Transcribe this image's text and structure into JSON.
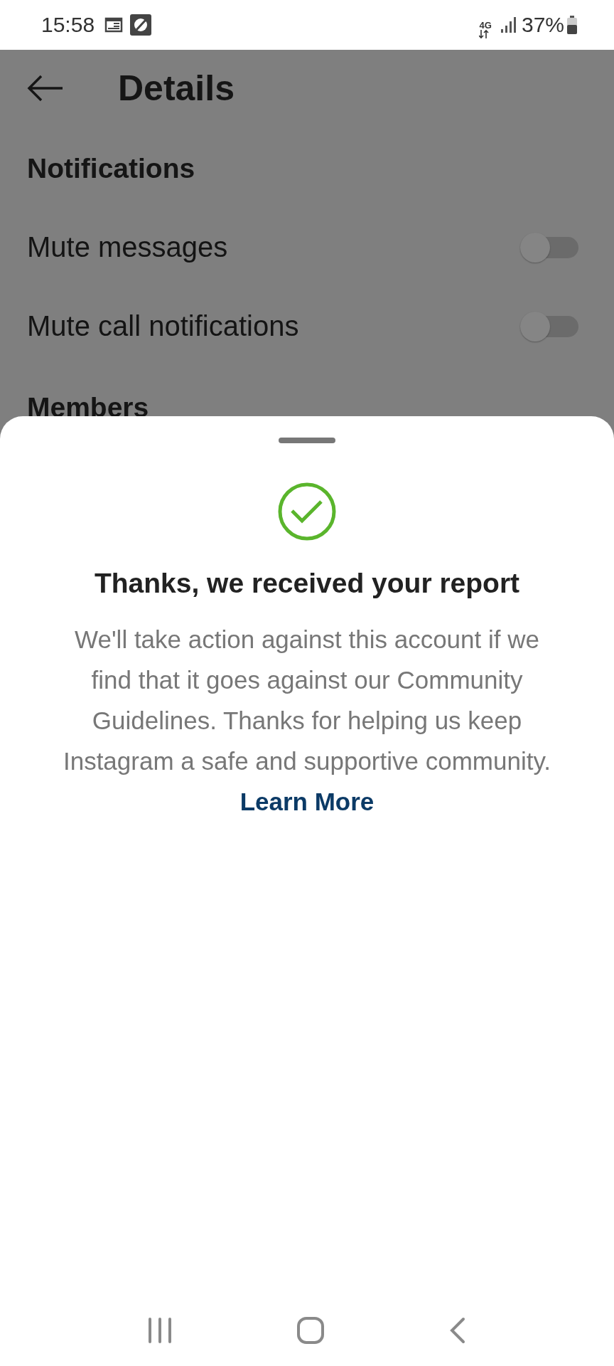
{
  "status_bar": {
    "time": "15:58",
    "network": "4G",
    "battery": "37%"
  },
  "header": {
    "title": "Details"
  },
  "sections": [
    {
      "title": "Notifications",
      "settings": [
        {
          "label": "Mute messages",
          "on": false
        },
        {
          "label": "Mute call notifications",
          "on": false
        }
      ]
    },
    {
      "title": "Members"
    }
  ],
  "sheet": {
    "title": "Thanks, we received your report",
    "body": "We'll take action against this account if we find that it goes against our Community Guidelines. Thanks for helping us keep Instagram a safe and supportive community.",
    "link": "Learn More"
  }
}
